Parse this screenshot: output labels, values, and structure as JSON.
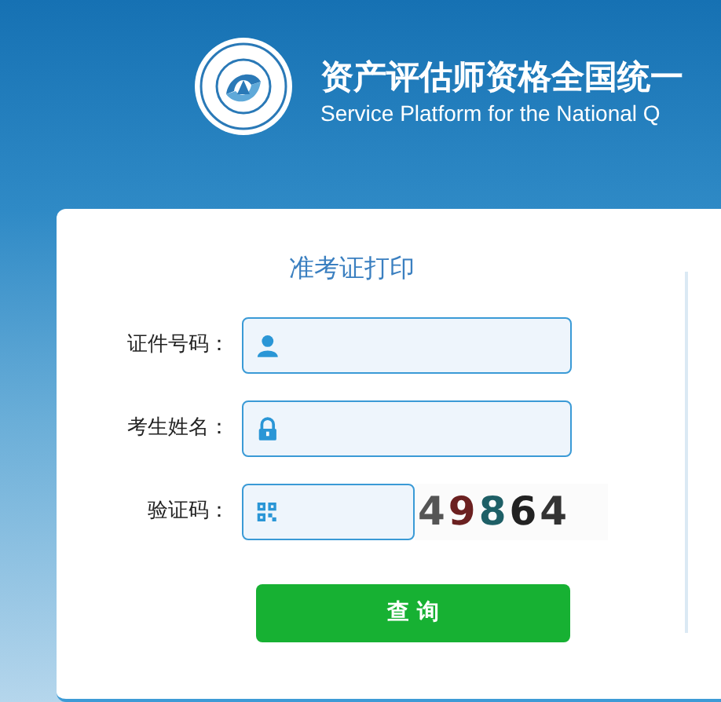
{
  "header": {
    "title": "资产评估师资格全国统一",
    "subtitle": "Service Platform for the National Q"
  },
  "form": {
    "heading": "准考证打印",
    "fields": [
      {
        "label": "证件号码："
      },
      {
        "label": "考生姓名："
      },
      {
        "label": "验证码：",
        "captcha": "49864"
      }
    ],
    "button": "查 询"
  }
}
